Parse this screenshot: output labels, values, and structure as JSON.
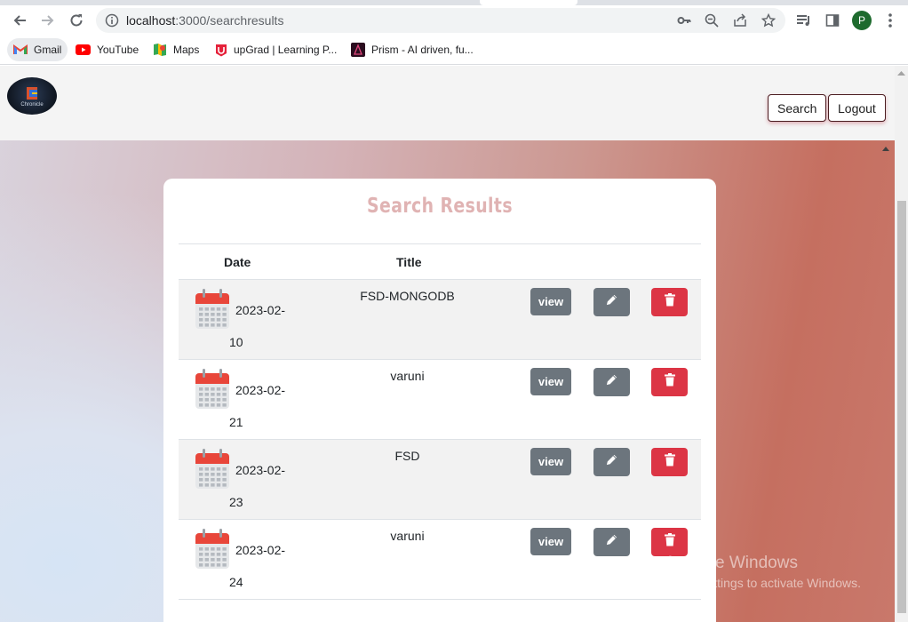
{
  "browser": {
    "url_host": "localhost",
    "url_rest": ":3000/searchresults",
    "profile_initial": "P",
    "bookmarks": [
      {
        "label": "Gmail",
        "icon": "gmail-icon"
      },
      {
        "label": "YouTube",
        "icon": "youtube-icon"
      },
      {
        "label": "Maps",
        "icon": "maps-icon"
      },
      {
        "label": "upGrad | Learning P...",
        "icon": "upgrad-icon"
      },
      {
        "label": "Prism - AI driven, fu...",
        "icon": "prism-icon"
      }
    ]
  },
  "app": {
    "logo_text": "Chronicle",
    "nav": {
      "search_label": "Search",
      "logout_label": "Logout"
    },
    "card_title": "Search Results",
    "table": {
      "headers": {
        "date": "Date",
        "title": "Title"
      },
      "rows": [
        {
          "date_line1": "2023-02-",
          "date_line2": "10",
          "title": "FSD-MONGODB",
          "view": "view"
        },
        {
          "date_line1": "2023-02-",
          "date_line2": "21",
          "title": "varuni",
          "view": "view"
        },
        {
          "date_line1": "2023-02-",
          "date_line2": "23",
          "title": "FSD",
          "view": "view"
        },
        {
          "date_line1": "2023-02-",
          "date_line2": "24",
          "title": "varuni",
          "view": "view"
        }
      ]
    },
    "colors": {
      "view": "#6c757d",
      "edit": "#6c757d",
      "delete": "#dc3545",
      "title": "#e0b3b3"
    }
  },
  "os": {
    "watermark_line1": "Activate Windows",
    "watermark_line2": "Go to Settings to activate Windows."
  }
}
